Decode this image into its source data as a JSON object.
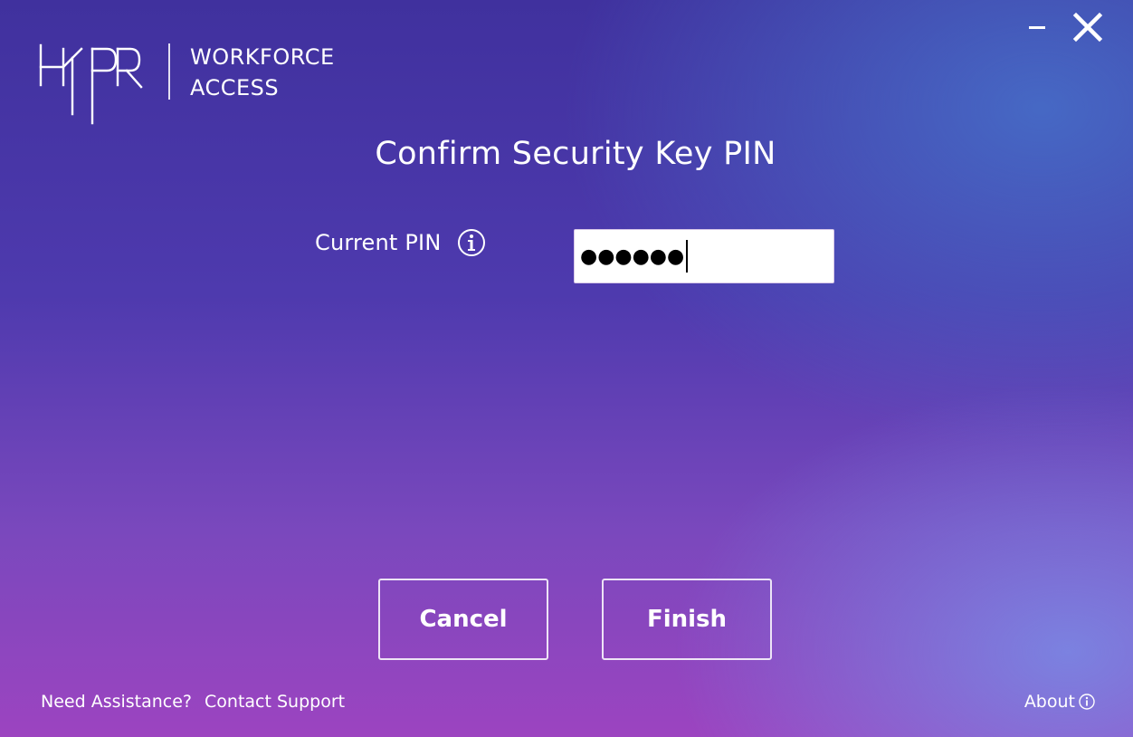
{
  "window": {
    "minimize_icon": "minimize-icon",
    "close_icon": "close-icon"
  },
  "brand": {
    "logo_text": "HYPR",
    "product_line1": "WORKFORCE",
    "product_line2": "ACCESS"
  },
  "page": {
    "title": "Confirm Security Key PIN"
  },
  "pin": {
    "label": "Current PIN",
    "info_icon": "info-icon",
    "masked_value": "●●●●●●"
  },
  "buttons": {
    "cancel_label": "Cancel",
    "finish_label": "Finish"
  },
  "footer": {
    "assistance_text": "Need Assistance?",
    "support_link": "Contact Support",
    "about_label": "About",
    "about_icon": "info-icon"
  },
  "colors": {
    "background_top": "#40319e",
    "background_bottom": "#9c44c0",
    "text": "#ffffff"
  }
}
